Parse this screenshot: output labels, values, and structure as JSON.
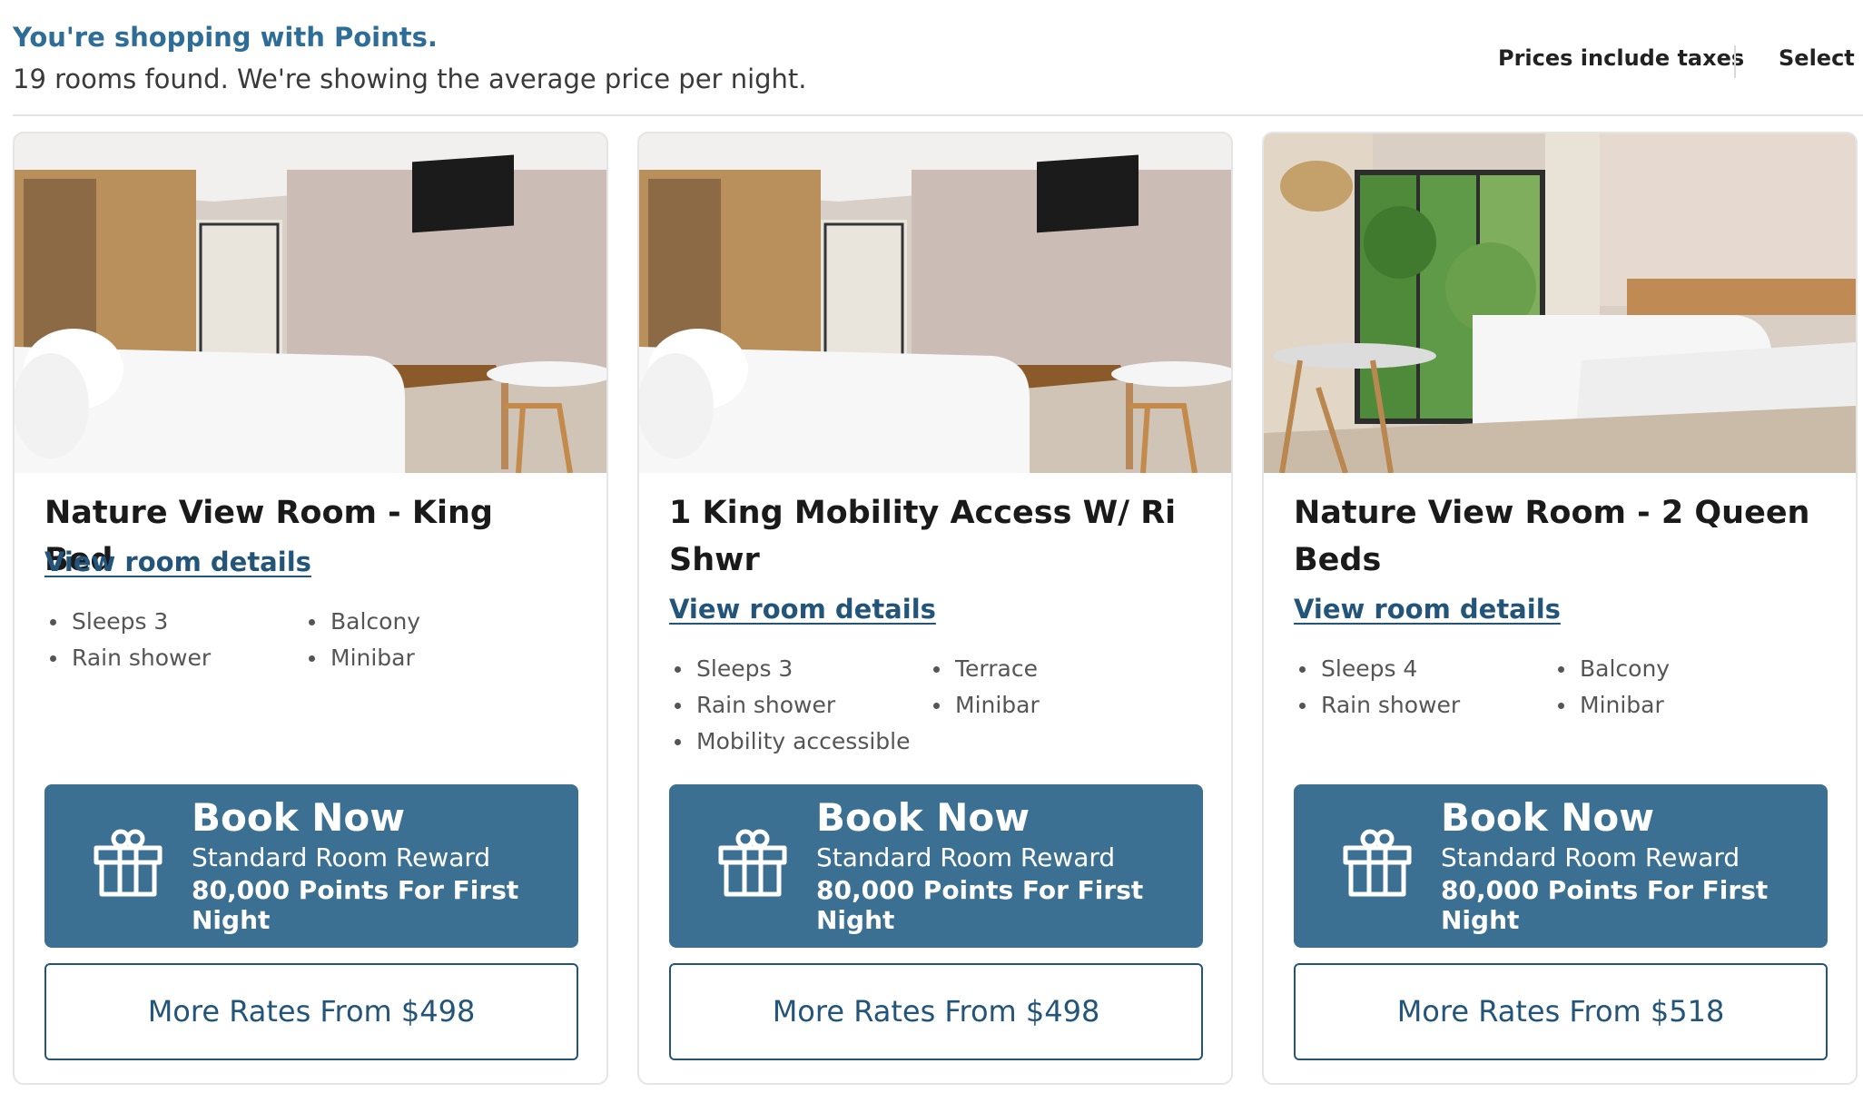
{
  "header": {
    "shopping_title": "You're shopping with Points.",
    "rooms_found": "19 rooms found. We're showing the average price per night.",
    "prices_note": "Prices include taxes",
    "currency_select": "Select c"
  },
  "rooms": [
    {
      "title": "Nature View Room - King Bed",
      "details_link": "View room details",
      "amenities_left": [
        "Sleeps 3",
        "Rain shower"
      ],
      "amenities_right": [
        "Balcony",
        "Minibar"
      ],
      "book_title": "Book Now",
      "book_subtitle": "Standard Room Reward",
      "book_points": "80,000 Points For First Night",
      "more_rates": "More Rates From $498"
    },
    {
      "title": "1 King Mobility Access W/ Ri Shwr",
      "details_link": "View room details",
      "amenities_left": [
        "Sleeps 3",
        "Rain shower",
        "Mobility accessible"
      ],
      "amenities_right": [
        "Terrace",
        "Minibar"
      ],
      "book_title": "Book Now",
      "book_subtitle": "Standard Room Reward",
      "book_points": "80,000 Points For First Night",
      "more_rates": "More Rates From $498"
    },
    {
      "title": "Nature View Room - 2 Queen Beds",
      "details_link": "View room details",
      "amenities_left": [
        "Sleeps 4",
        "Rain shower"
      ],
      "amenities_right": [
        "Balcony",
        "Minibar"
      ],
      "book_title": "Book Now",
      "book_subtitle": "Standard Room Reward",
      "book_points": "80,000 Points For First Night",
      "more_rates": "More Rates From $518"
    }
  ],
  "icons": {
    "book_button": "gift-icon"
  },
  "colors": {
    "accent_link": "#23557a",
    "header_blue": "#2e6d97",
    "book_button_bg": "#3b7093"
  }
}
